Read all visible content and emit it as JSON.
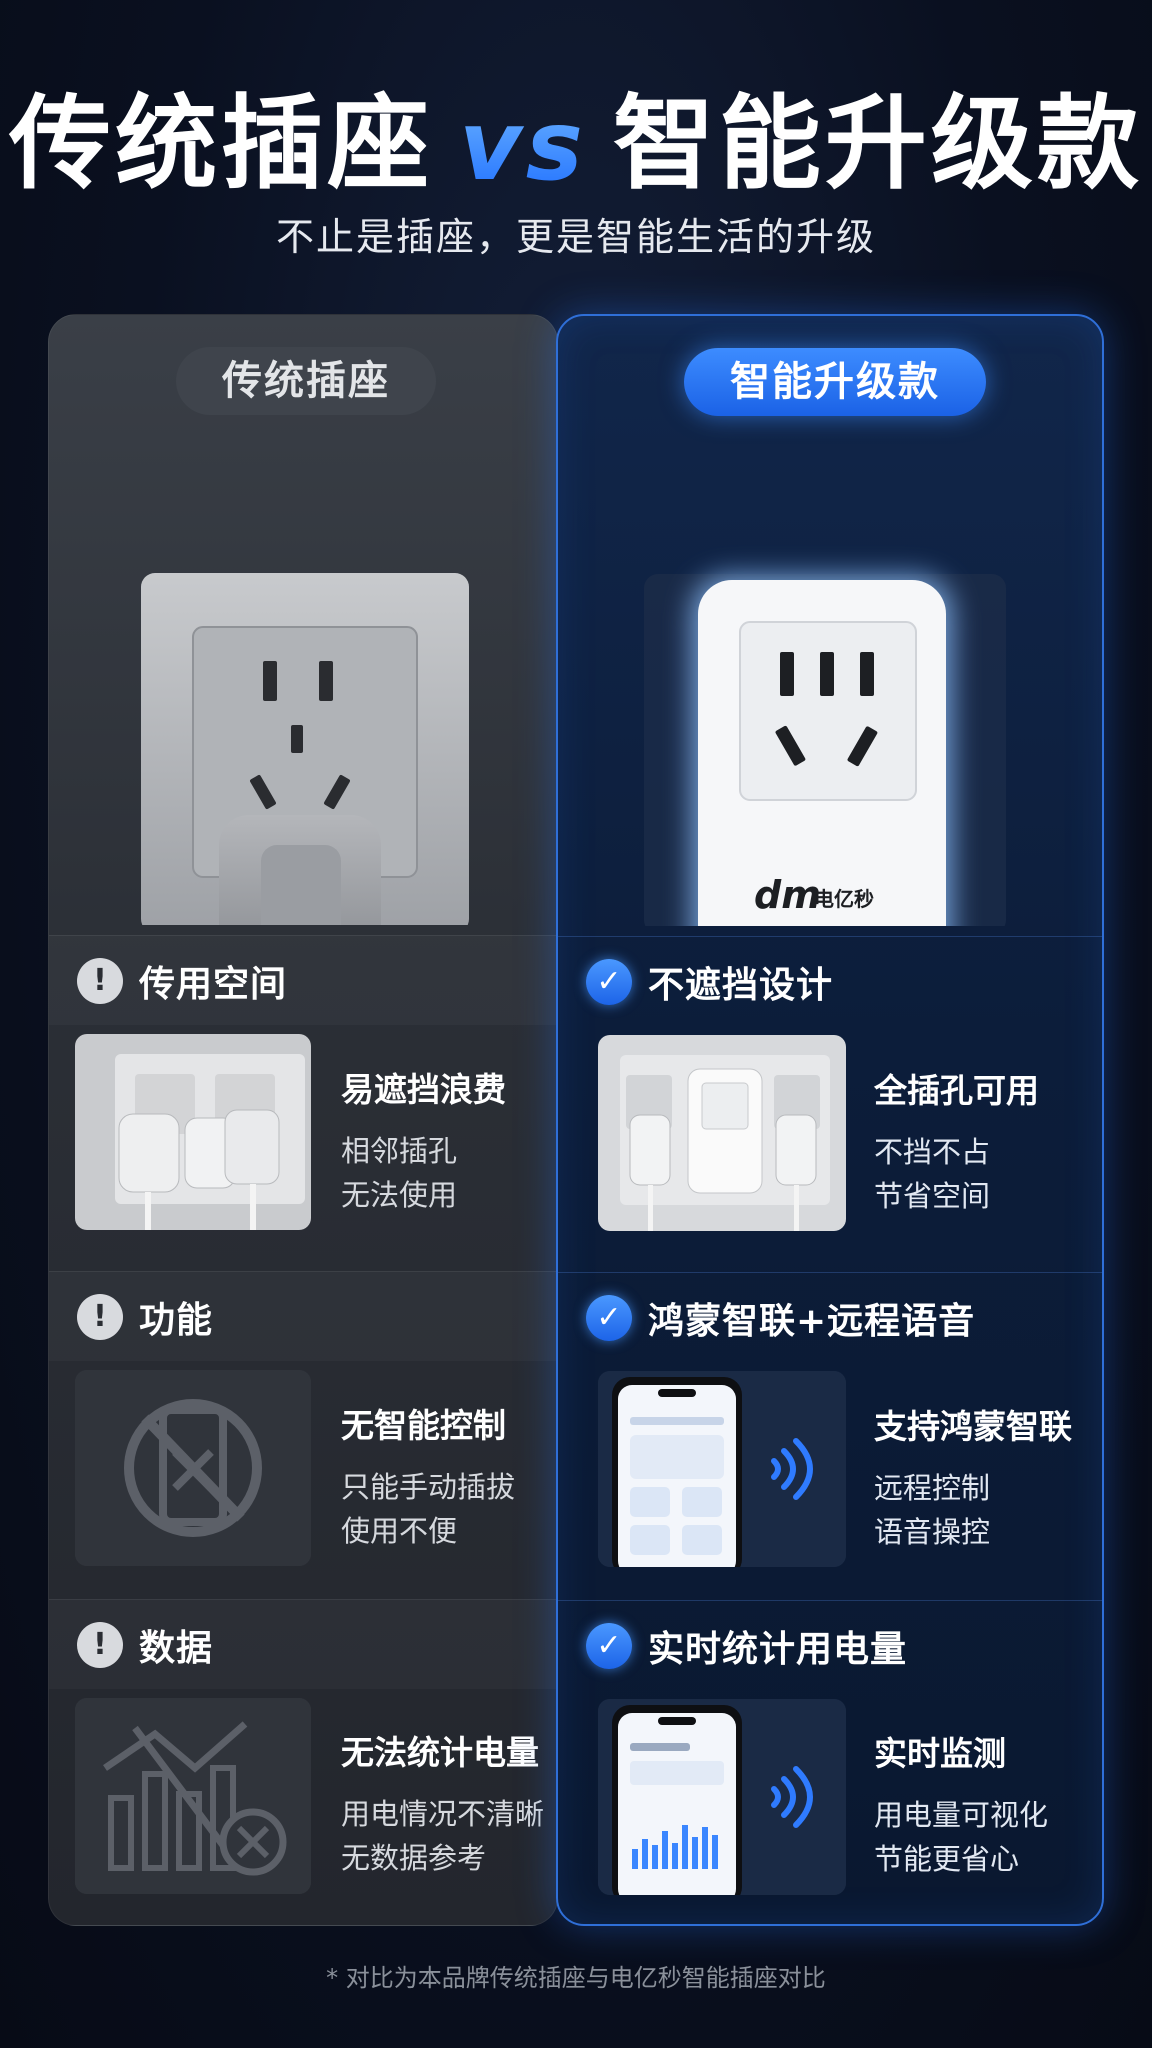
{
  "header": {
    "title_left": "传统插座",
    "title_vs": "vs",
    "title_right": "智能升级款",
    "subtitle": "不止是插座，更是智能生活的升级"
  },
  "left": {
    "pill": "传统插座",
    "sections": [
      {
        "heading": "传用空间",
        "title": "易遮挡浪费",
        "lines": [
          "相邻插孔",
          "无法使用"
        ]
      },
      {
        "heading": "功能",
        "title": "无智能控制",
        "lines": [
          "只能手动插拔",
          "使用不便"
        ]
      },
      {
        "heading": "数据",
        "title": "无法统计电量",
        "lines": [
          "用电情况不清晰",
          "无数据参考"
        ]
      }
    ]
  },
  "right": {
    "pill": "智能升级款",
    "brand": "电亿秒",
    "sections": [
      {
        "heading": "不遮挡设计",
        "title": "全插孔可用",
        "lines": [
          "不挡不占",
          "节省空间"
        ]
      },
      {
        "heading": "鸿蒙智联+远程语音",
        "title": "支持鸿蒙智联",
        "lines": [
          "远程控制",
          "语音操控"
        ]
      },
      {
        "heading": "实时统计用电量",
        "title": "实时监测",
        "lines": [
          "用电量可视化",
          "节能更省心"
        ]
      }
    ]
  },
  "footnote": "* 对比为本品牌传统插座与电亿秒智能插座对比",
  "colors": {
    "accent": "#1f6fff",
    "warn_badge": "#d8dade"
  },
  "icons": [
    "warning-icon",
    "check-icon",
    "no-phone-icon",
    "chart-crossed-icon",
    "signal-waves-icon"
  ]
}
